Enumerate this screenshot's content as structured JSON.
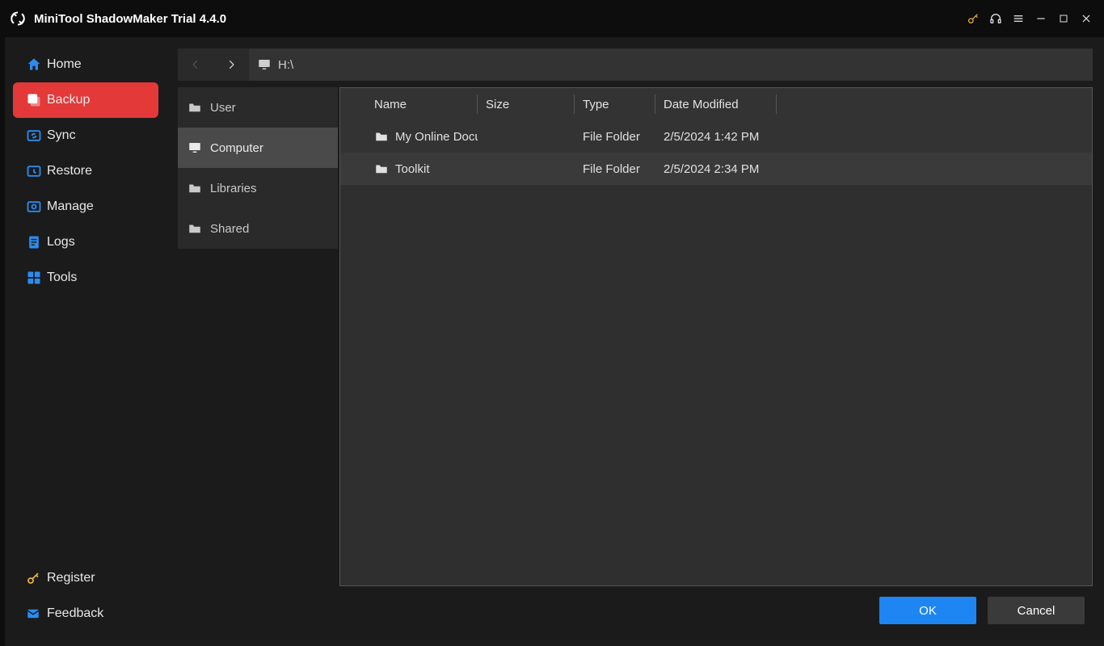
{
  "app": {
    "title": "MiniTool ShadowMaker Trial 4.4.0"
  },
  "sidebar": {
    "items": [
      {
        "label": "Home",
        "key": "home"
      },
      {
        "label": "Backup",
        "key": "backup"
      },
      {
        "label": "Sync",
        "key": "sync"
      },
      {
        "label": "Restore",
        "key": "restore"
      },
      {
        "label": "Manage",
        "key": "manage"
      },
      {
        "label": "Logs",
        "key": "logs"
      },
      {
        "label": "Tools",
        "key": "tools"
      }
    ],
    "footer": [
      {
        "label": "Register",
        "key": "register"
      },
      {
        "label": "Feedback",
        "key": "feedback"
      }
    ]
  },
  "pathbar": {
    "path_text": "H:\\"
  },
  "categories": [
    {
      "label": "User",
      "key": "user"
    },
    {
      "label": "Computer",
      "key": "computer"
    },
    {
      "label": "Libraries",
      "key": "libraries"
    },
    {
      "label": "Shared",
      "key": "shared"
    }
  ],
  "table": {
    "columns": {
      "name": "Name",
      "size": "Size",
      "type": "Type",
      "date": "Date Modified"
    },
    "rows": [
      {
        "name": "My Online Docu…",
        "size": "",
        "type": "File Folder",
        "date": "2/5/2024 1:42 PM"
      },
      {
        "name": "Toolkit",
        "size": "",
        "type": "File Folder",
        "date": "2/5/2024 2:34 PM"
      }
    ]
  },
  "footer": {
    "ok": "OK",
    "cancel": "Cancel"
  }
}
